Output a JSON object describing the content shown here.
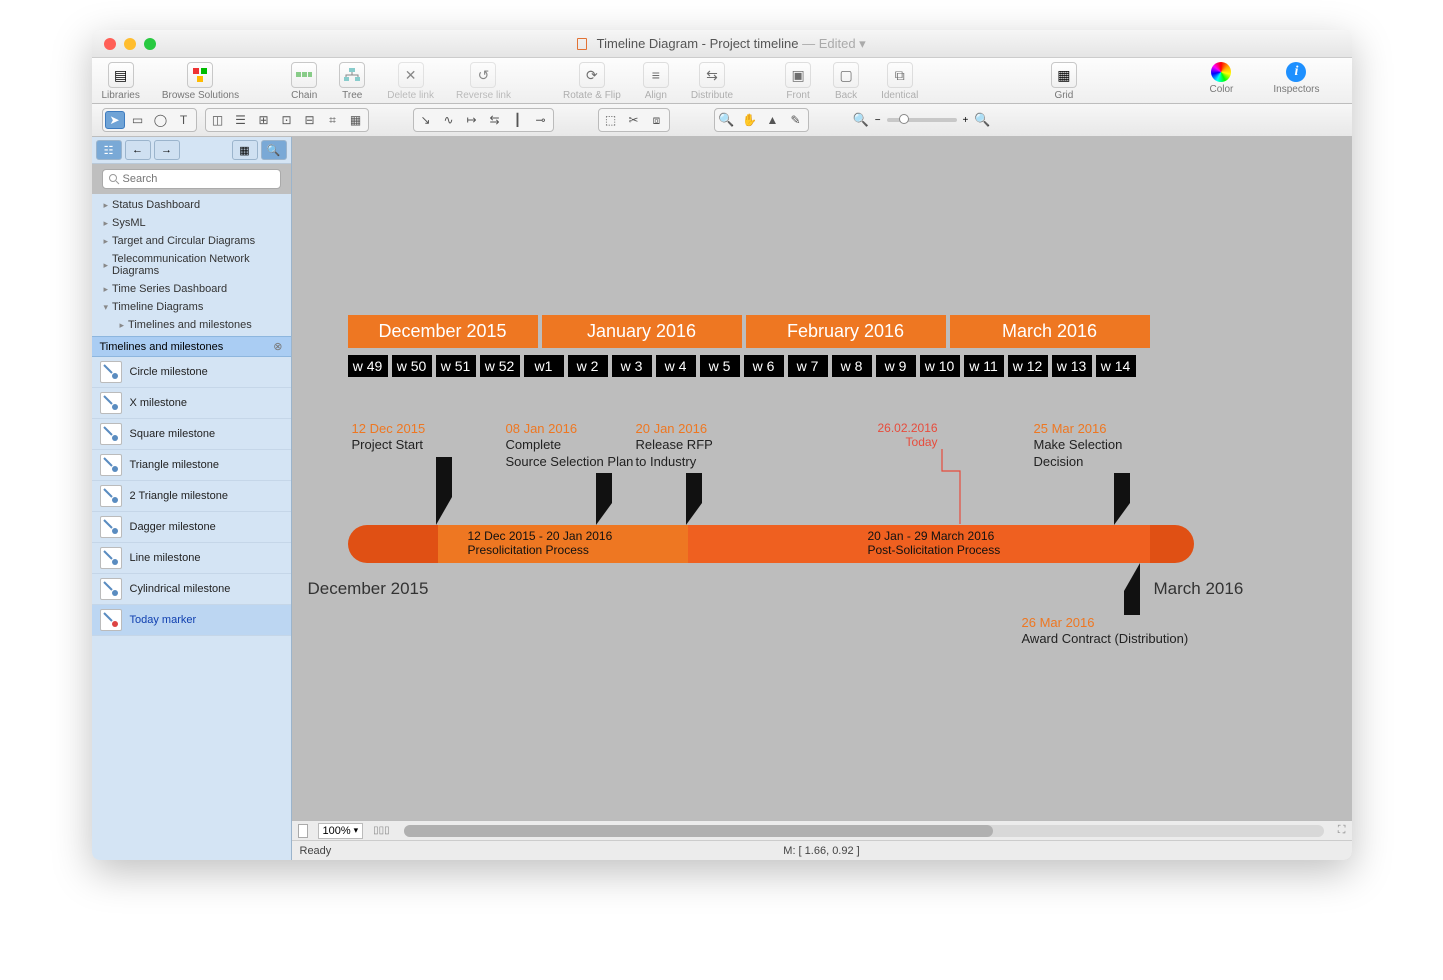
{
  "window": {
    "title_prefix": "Timeline Diagram - Project timeline",
    "edited_suffix": " — Edited ▾"
  },
  "toolbar": {
    "libraries": "Libraries",
    "browse": "Browse Solutions",
    "chain": "Chain",
    "tree": "Tree",
    "delete_link": "Delete link",
    "reverse_link": "Reverse link",
    "rotate": "Rotate & Flip",
    "align": "Align",
    "distribute": "Distribute",
    "front": "Front",
    "back": "Back",
    "identical": "Identical",
    "grid": "Grid",
    "color": "Color",
    "inspectors": "Inspectors"
  },
  "search": {
    "placeholder": "Search"
  },
  "sidebar": {
    "categories": [
      "Status Dashboard",
      "SysML",
      "Target and Circular Diagrams",
      "Telecommunication Network Diagrams",
      "Time Series Dashboard",
      "Timeline Diagrams"
    ],
    "expanded_child": "Timelines and milestones",
    "section_header": "Timelines and milestones",
    "shapes": [
      "Circle milestone",
      "X milestone",
      "Square milestone",
      "Triangle milestone",
      "2 Triangle milestone",
      "Dagger milestone",
      "Line milestone",
      "Cylindrical milestone",
      "Today marker"
    ],
    "selected_shape_index": 8
  },
  "timeline": {
    "months": [
      "December 2015",
      "January 2016",
      "February 2016",
      "March 2016"
    ],
    "month_widths": [
      190,
      200,
      200,
      200
    ],
    "weeks": [
      "w 49",
      "w 50",
      "w 51",
      "w 52",
      "w1",
      "w 2",
      "w 3",
      "w 4",
      "w 5",
      "w 6",
      "w 7",
      "w 8",
      "w 9",
      "w 10",
      "w 11",
      "w 12",
      "w 13",
      "w 14"
    ],
    "range_start": "December 2015",
    "range_end": "March 2016",
    "phase1": {
      "range": "12 Dec 2015 - 20 Jan 2016",
      "name": "Presolicitation Process"
    },
    "phase2": {
      "range": "20 Jan - 29 March 2016",
      "name": "Post-Solicitation Process"
    },
    "today": {
      "date": "26.02.2016",
      "label": "Today"
    },
    "milestones": {
      "start": {
        "date": "12 Dec 2015",
        "text": "Project Start"
      },
      "complete": {
        "date": "08 Jan 2016",
        "text1": "Complete",
        "text2": "Source Selection Plan"
      },
      "release": {
        "date": "20 Jan 2016",
        "text1": "Release RFP",
        "text2": "to Industry"
      },
      "decide": {
        "date": "25 Mar 2016",
        "text1": "Make Selection",
        "text2": "Decision"
      },
      "award": {
        "date": "26 Mar 2016",
        "text": "Award Contract (Distribution)"
      }
    }
  },
  "footer": {
    "zoom": "100%",
    "mouse": "M: [ 1.66, 0.92 ]",
    "status": "Ready"
  },
  "colors": {
    "orange": "#ee7722",
    "orange_dark": "#e05014",
    "orange_mid": "#ef6c1f",
    "red": "#e74c3c"
  }
}
